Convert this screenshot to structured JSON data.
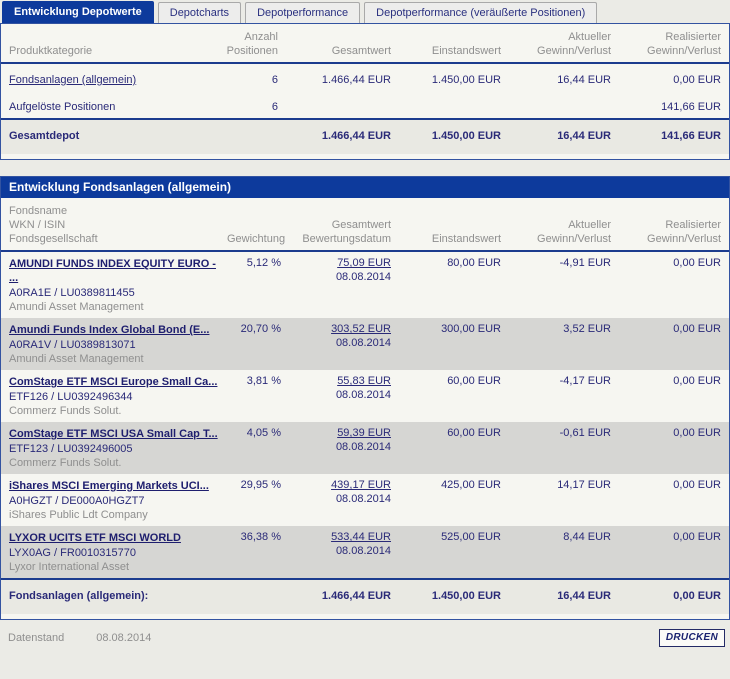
{
  "colors": {
    "accent_navy": "#0d3a9c",
    "panel_border": "#3353a1",
    "row_alt": "#d6d6d3",
    "text_navy": "#2a2a78",
    "text_gray": "#8f8f8f"
  },
  "tabs": [
    {
      "label": "Entwicklung Depotwerte",
      "active": true
    },
    {
      "label": "Depotcharts",
      "active": false
    },
    {
      "label": "Depotperformance",
      "active": false
    },
    {
      "label": "Depotperformance (veräußerte Positionen)",
      "active": false
    }
  ],
  "summary": {
    "headers": {
      "category": "Produktkategorie",
      "positions_l1": "Anzahl",
      "positions_l2": "Positionen",
      "total": "Gesamtwert",
      "cost": "Einstandswert",
      "current_l1": "Aktueller",
      "current_l2": "Gewinn/Verlust",
      "realized_l1": "Realisierter",
      "realized_l2": "Gewinn/Verlust"
    },
    "rows": [
      {
        "category": "Fondsanlagen (allgemein)",
        "positions": "6",
        "total": "1.466,44 EUR",
        "cost": "1.450,00 EUR",
        "current": "16,44 EUR",
        "realized": "0,00 EUR"
      },
      {
        "category": "Aufgelöste Positionen",
        "positions": "6",
        "total": "",
        "cost": "",
        "current": "",
        "realized": "141,66 EUR"
      }
    ],
    "footer": {
      "label": "Gesamtdepot",
      "total": "1.466,44 EUR",
      "cost": "1.450,00 EUR",
      "current": "16,44 EUR",
      "realized": "141,66 EUR"
    }
  },
  "funds": {
    "title": "Entwicklung Fondsanlagen (allgemein)",
    "headers": {
      "name_l1": "Fondsname",
      "name_l2": "WKN / ISIN",
      "name_l3": "Fondsgesellschaft",
      "weight": "Gewichtung",
      "total_l1": "Gesamtwert",
      "total_l2": "Bewertungsdatum",
      "cost": "Einstandswert",
      "current_l1": "Aktueller",
      "current_l2": "Gewinn/Verlust",
      "realized_l1": "Realisierter",
      "realized_l2": "Gewinn/Verlust"
    },
    "rows": [
      {
        "name": "AMUNDI FUNDS INDEX EQUITY EURO - ...",
        "wkn": "A0RA1E / LU0389811455",
        "company": "Amundi Asset Management",
        "weight": "5,12 %",
        "total": "75,09 EUR",
        "date": "08.08.2014",
        "cost": "80,00 EUR",
        "current": "-4,91 EUR",
        "realized": "0,00 EUR"
      },
      {
        "name": "Amundi Funds Index Global Bond (E...",
        "wkn": "A0RA1V / LU0389813071",
        "company": "Amundi Asset Management",
        "weight": "20,70 %",
        "total": "303,52 EUR",
        "date": "08.08.2014",
        "cost": "300,00 EUR",
        "current": "3,52 EUR",
        "realized": "0,00 EUR"
      },
      {
        "name": "ComStage ETF MSCI Europe Small Ca...",
        "wkn": "ETF126 / LU0392496344",
        "company": "Commerz Funds Solut.",
        "weight": "3,81 %",
        "total": "55,83 EUR",
        "date": "08.08.2014",
        "cost": "60,00 EUR",
        "current": "-4,17 EUR",
        "realized": "0,00 EUR"
      },
      {
        "name": "ComStage ETF MSCI USA Small Cap T...",
        "wkn": "ETF123 / LU0392496005",
        "company": "Commerz Funds Solut.",
        "weight": "4,05 %",
        "total": "59,39 EUR",
        "date": "08.08.2014",
        "cost": "60,00 EUR",
        "current": "-0,61 EUR",
        "realized": "0,00 EUR"
      },
      {
        "name": "iShares MSCI Emerging Markets UCI...",
        "wkn": "A0HGZT / DE000A0HGZT7",
        "company": "iShares Public Ldt Company",
        "weight": "29,95 %",
        "total": "439,17 EUR",
        "date": "08.08.2014",
        "cost": "425,00 EUR",
        "current": "14,17 EUR",
        "realized": "0,00 EUR"
      },
      {
        "name": "LYXOR UCITS ETF MSCI WORLD",
        "wkn": "LYX0AG / FR0010315770",
        "company": "Lyxor International Asset",
        "weight": "36,38 %",
        "total": "533,44 EUR",
        "date": "08.08.2014",
        "cost": "525,00 EUR",
        "current": "8,44 EUR",
        "realized": "0,00 EUR"
      }
    ],
    "footer": {
      "label": "Fondsanlagen (allgemein):",
      "total": "1.466,44 EUR",
      "cost": "1.450,00 EUR",
      "current": "16,44 EUR",
      "realized": "0,00 EUR"
    }
  },
  "statusbar": {
    "datenstand_label": "Datenstand",
    "datenstand_value": "08.08.2014",
    "print_button": "DRUCKEN"
  }
}
